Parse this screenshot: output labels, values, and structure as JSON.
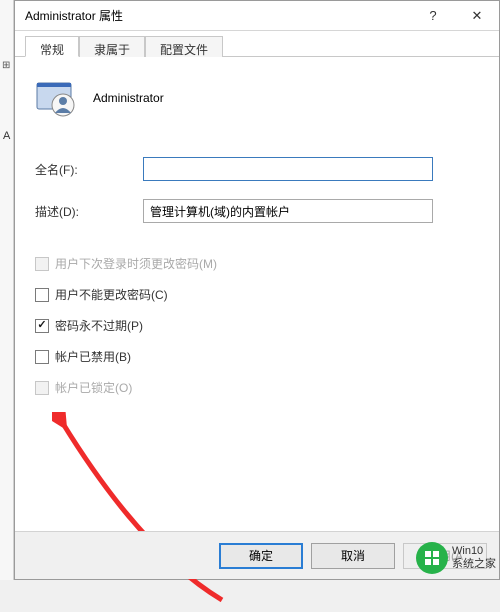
{
  "window": {
    "title": "Administrator 属性"
  },
  "tabs": [
    {
      "label": "常规",
      "active": true
    },
    {
      "label": "隶属于",
      "active": false
    },
    {
      "label": "配置文件",
      "active": false
    }
  ],
  "header": {
    "username": "Administrator"
  },
  "fields": {
    "fullname_label": "全名(F):",
    "fullname_value": "",
    "description_label": "描述(D):",
    "description_value": "管理计算机(域)的内置帐户"
  },
  "checks": {
    "must_change_pw": {
      "label": "用户下次登录时须更改密码(M)",
      "checked": false,
      "disabled": true
    },
    "cannot_change_pw": {
      "label": "用户不能更改密码(C)",
      "checked": false,
      "disabled": false
    },
    "pw_never_expires": {
      "label": "密码永不过期(P)",
      "checked": true,
      "disabled": false
    },
    "account_disabled": {
      "label": "帐户已禁用(B)",
      "checked": false,
      "disabled": false
    },
    "account_locked": {
      "label": "帐户已锁定(O)",
      "checked": false,
      "disabled": true
    }
  },
  "buttons": {
    "ok": "确定",
    "cancel": "取消",
    "apply": "应用(A"
  },
  "watermark": {
    "line1": "Win10",
    "line2": "系统之家"
  }
}
